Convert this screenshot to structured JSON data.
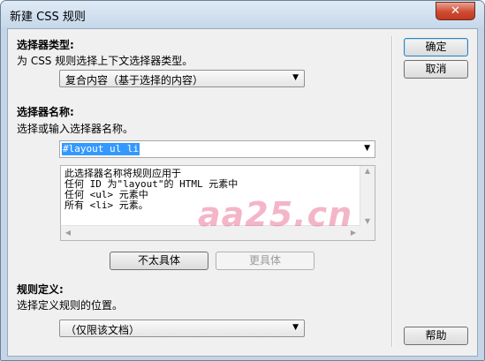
{
  "window": {
    "title": "新建 CSS 规则",
    "close_label": "✕"
  },
  "selector_type": {
    "heading": "选择器类型:",
    "description": "为 CSS 规则选择上下文选择器类型。",
    "selected": "复合内容（基于选择的内容）"
  },
  "selector_name": {
    "heading": "选择器名称:",
    "description": "选择或输入选择器名称。",
    "value": "#layout ul li",
    "explanation_lines": [
      "此选择器名称将规则应用于",
      "任何 ID 为\"layout\"的 HTML 元素中",
      "任何 <ul> 元素中",
      "所有 <li> 元素。"
    ]
  },
  "specificity": {
    "less_label": "不太具体",
    "more_label": "更具体"
  },
  "rule_definition": {
    "heading": "规则定义:",
    "description": "选择定义规则的位置。",
    "selected": "（仅限该文档）"
  },
  "buttons": {
    "ok_label": "确定",
    "cancel_label": "取消",
    "help_label": "帮助"
  },
  "watermark": "aa25.cn"
}
